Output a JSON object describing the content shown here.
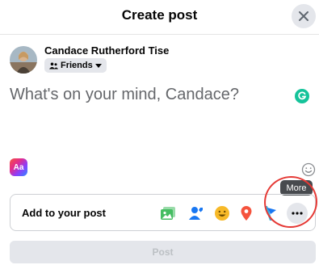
{
  "dialog": {
    "title": "Create post"
  },
  "user": {
    "name": "Candace Rutherford Tise",
    "audience": "Friends"
  },
  "composer": {
    "placeholder": "What's on your mind, Candace?"
  },
  "background_picker": {
    "label": "Aa"
  },
  "add_to_post": {
    "label": "Add to your post"
  },
  "tooltip": {
    "text": "More"
  },
  "post_button": {
    "label": "Post"
  },
  "colors": {
    "photo": "#45bd62",
    "tag": "#1877f2",
    "feeling": "#f7b928",
    "checkin": "#f5533d",
    "annotation": "#e53935",
    "grammarly": "#15c39a"
  }
}
